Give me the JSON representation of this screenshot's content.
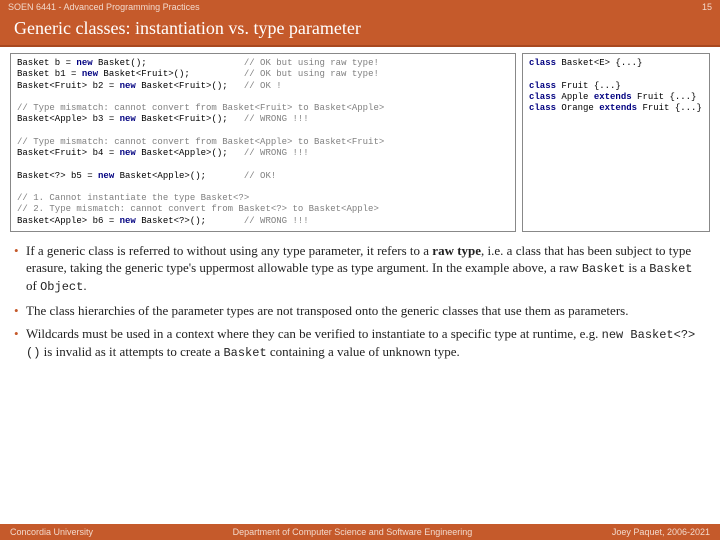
{
  "header": {
    "course": "SOEN 6441 - Advanced Programming Practices",
    "pagenum": "15",
    "title": "Generic classes: instantiation vs. type parameter"
  },
  "code": {
    "l1a": "Basket b = ",
    "l1b": "new",
    "l1c": " Basket();                  ",
    "l1d": "// OK but using raw type!",
    "l2a": "Basket b1 = ",
    "l2b": "new",
    "l2c": " Basket<Fruit>();          ",
    "l2d": "// OK but using raw type!",
    "l3a": "Basket<Fruit> b2 = ",
    "l3b": "new",
    "l3c": " Basket<Fruit>();   ",
    "l3d": "// OK !",
    "l4": "// Type mismatch: cannot convert from Basket<Fruit> to Basket<Apple>",
    "l5a": "Basket<Apple> b3 = ",
    "l5b": "new",
    "l5c": " Basket<Fruit>();   ",
    "l5d": "// WRONG !!!",
    "l6": "// Type mismatch: cannot convert from Basket<Apple> to Basket<Fruit>",
    "l7a": "Basket<Fruit> b4 = ",
    "l7b": "new",
    "l7c": " Basket<Apple>();   ",
    "l7d": "// WRONG !!!",
    "l8a": "Basket<?> b5 = ",
    "l8b": "new",
    "l8c": " Basket<Apple>();       ",
    "l8d": "// OK!",
    "l9": "// 1. Cannot instantiate the type Basket<?>",
    "l10": "// 2. Type mismatch: cannot convert from Basket<?> to Basket<Apple>",
    "l11a": "Basket<Apple> b6 = ",
    "l11b": "new",
    "l11c": " Basket<?>();       ",
    "l11d": "// WRONG !!!",
    "r1a": "class",
    "r1b": " Basket<E> {...}",
    "r2a": "class",
    "r2b": " Fruit {...}",
    "r3a": "class",
    "r3b": " Apple ",
    "r3c": "extends",
    "r3d": " Fruit {...}",
    "r4a": "class",
    "r4b": " Orange ",
    "r4c": "extends",
    "r4d": " Fruit {...}"
  },
  "bul": {
    "b1a": "If a generic class is referred to without using any type parameter, it refers to a ",
    "b1b": "raw type",
    "b1c": ", i.e. a class that has been subject to type erasure, taking the generic type's uppermost allowable type as type argument. In the example above, a raw ",
    "b1d": "Basket",
    "b1e": " is a ",
    "b1f": "Basket",
    "b1g": " of ",
    "b1h": "Object",
    "b1i": ".",
    "b2": "The class hierarchies of the parameter types are not transposed onto the generic classes that use them as parameters.",
    "b3a": "Wildcards must be used in a context where they can be verified to instantiate to a specific type at runtime, e.g. ",
    "b3b": "new Basket<?>()",
    "b3c": " is invalid as it attempts to create a ",
    "b3d": "Basket",
    "b3e": " containing a value of unknown type."
  },
  "footer": {
    "left": "Concordia University",
    "center": "Department of Computer Science and Software Engineering",
    "right": "Joey Paquet, 2006-2021"
  }
}
